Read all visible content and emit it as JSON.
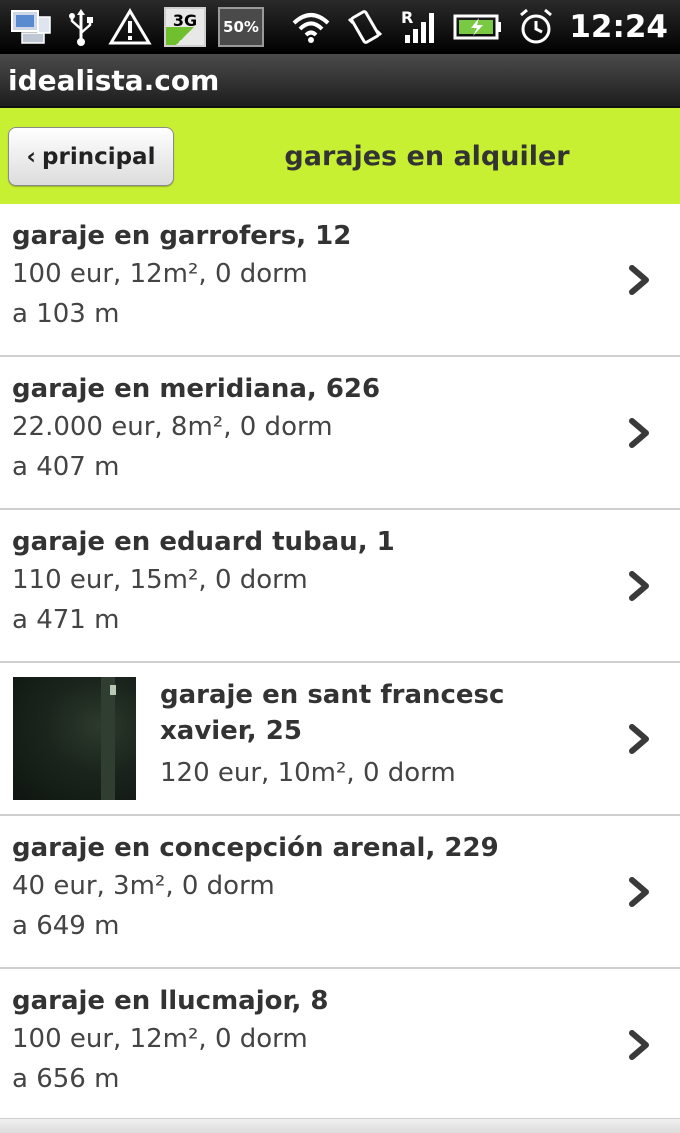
{
  "status_bar": {
    "network_badge": "3G",
    "battery_badge": "50%",
    "time": "12:24",
    "icons": [
      "computer-icon",
      "usb-icon",
      "warning-icon",
      "3g-signal-icon",
      "battery-percent-icon",
      "wifi-icon",
      "vibrate-icon",
      "roaming-signal-icon",
      "battery-charging-icon",
      "alarm-icon"
    ]
  },
  "app_title": "idealista.com",
  "header": {
    "back_label": "principal",
    "back_chevron": "‹",
    "title": "garajes en alquiler",
    "accent_color": "#c8f032"
  },
  "listings": [
    {
      "title": "garaje en garrofers, 12",
      "details": "100 eur, 12m², 0 dorm",
      "distance": "a 103 m"
    },
    {
      "title": "garaje en meridiana, 626",
      "details": "22.000 eur, 8m², 0 dorm",
      "distance": "a 407 m"
    },
    {
      "title": "garaje en eduard tubau, 1",
      "details": "110 eur, 15m², 0 dorm",
      "distance": "a 471 m"
    },
    {
      "title": "garaje en sant francesc xavier, 25",
      "details": "120 eur, 10m², 0 dorm",
      "distance": "",
      "has_photo": true
    },
    {
      "title": "garaje en concepción arenal, 229",
      "details": "40 eur, 3m², 0 dorm",
      "distance": "a 649 m"
    },
    {
      "title": "garaje en llucmajor, 8",
      "details": "100 eur, 12m², 0 dorm",
      "distance": "a 656 m"
    }
  ]
}
